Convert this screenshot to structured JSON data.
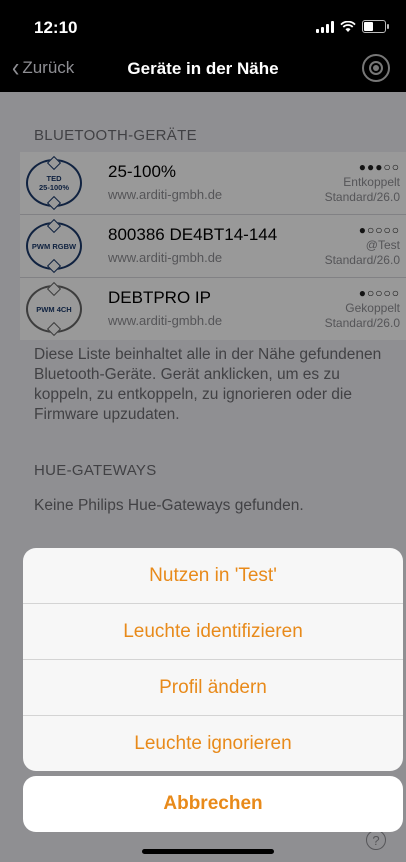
{
  "status": {
    "time": "12:10"
  },
  "nav": {
    "back_label": "Zurück",
    "title": "Geräte in der Nähe"
  },
  "sections": {
    "bluetooth_header": "BLUETOOTH-GERÄTE",
    "hue_header": "HUE-GATEWAYS"
  },
  "devices": [
    {
      "badge": "TED\n25-100%",
      "name": "25-100%",
      "url": "www.arditi-gmbh.de",
      "signal": "●●●○○",
      "status": "Entkoppelt",
      "profile": "Standard/26.0"
    },
    {
      "badge": "PWM RGBW",
      "name": "800386 DE4BT14-144",
      "url": "www.arditi-gmbh.de",
      "signal": "●○○○○",
      "status": "@Test",
      "profile": "Standard/26.0"
    },
    {
      "badge": "PWM 4CH",
      "name": "DEBTPRO IP",
      "url": "www.arditi-gmbh.de",
      "signal": "●○○○○",
      "status": "Gekoppelt",
      "profile": "Standard/26.0"
    }
  ],
  "info_text": "Diese Liste beinhaltet alle in der Nähe gefundenen Bluetooth-Geräte. Gerät anklicken, um es zu koppeln, zu entkoppeln, zu ignorieren oder die Firmware upzudaten.",
  "hue_empty": "Keine Philips Hue-Gateways gefunden.",
  "help_label": "?",
  "action_sheet": {
    "items": [
      "Nutzen in 'Test'",
      "Leuchte identifizieren",
      "Profil ändern",
      "Leuchte ignorieren"
    ],
    "cancel": "Abbrechen"
  },
  "colors": {
    "accent": "#e88a1a",
    "badge_blue": "#1b3a6b"
  }
}
